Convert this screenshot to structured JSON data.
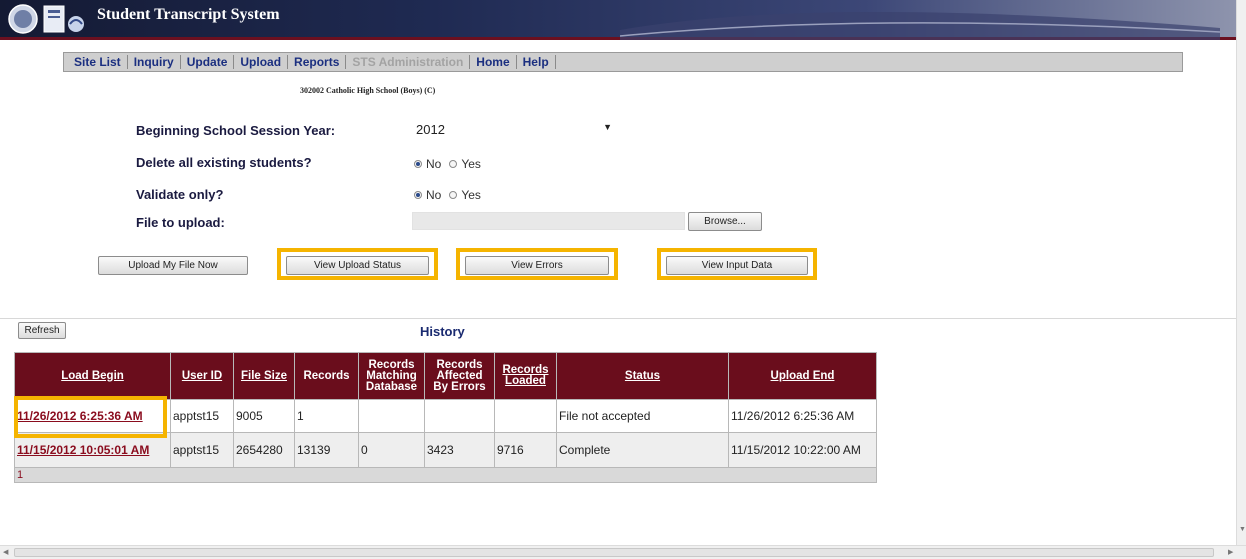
{
  "header": {
    "app_title": "Student Transcript System"
  },
  "nav": {
    "items": [
      {
        "label": "Site List",
        "disabled": false
      },
      {
        "label": "Inquiry",
        "disabled": false
      },
      {
        "label": "Update",
        "disabled": false
      },
      {
        "label": "Upload",
        "disabled": false
      },
      {
        "label": "Reports",
        "disabled": false
      },
      {
        "label": "STS Administration",
        "disabled": true
      },
      {
        "label": "Home",
        "disabled": false
      },
      {
        "label": "Help",
        "disabled": false
      }
    ]
  },
  "school_line": "302002 Catholic High School (Boys) (C)",
  "form": {
    "session_year_label": "Beginning School Session Year:",
    "session_year_value": "2012",
    "delete_label": "Delete all existing students?",
    "delete_no": "No",
    "delete_yes": "Yes",
    "validate_label": "Validate only?",
    "validate_no": "No",
    "validate_yes": "Yes",
    "file_label": "File to upload:",
    "browse_label": "Browse..."
  },
  "buttons": {
    "upload_now": "Upload My File Now",
    "view_status": "View Upload Status",
    "view_errors": "View Errors",
    "view_input": "View Input Data",
    "refresh": "Refresh"
  },
  "history": {
    "title": "History",
    "columns": {
      "load_begin": "Load Begin",
      "user_id": "User ID",
      "file_size": "File Size",
      "records": "Records",
      "matching": [
        "Records",
        "Matching",
        "Database"
      ],
      "affected": [
        "Records",
        "Affected",
        "By Errors"
      ],
      "loaded": [
        "Records",
        "Loaded"
      ],
      "status": "Status",
      "upload_end": "Upload End"
    },
    "rows": [
      {
        "load_begin": "11/26/2012 6:25:36 AM",
        "user_id": "apptst15",
        "file_size": "9005",
        "records": "1",
        "matching": "",
        "affected": "",
        "loaded": "",
        "status": "File not accepted",
        "upload_end": "11/26/2012 6:25:36 AM"
      },
      {
        "load_begin": "11/15/2012 10:05:01 AM",
        "user_id": "apptst15",
        "file_size": "2654280",
        "records": "13139",
        "matching": "0",
        "affected": "3423",
        "loaded": "9716",
        "status": "Complete",
        "upload_end": "11/15/2012 10:22:00 AM"
      }
    ],
    "pager": "1"
  },
  "colors": {
    "header_border": "#6b1020",
    "table_header": "#6a0d1c",
    "highlight": "#f5b400",
    "link": "#8a0c1e"
  }
}
